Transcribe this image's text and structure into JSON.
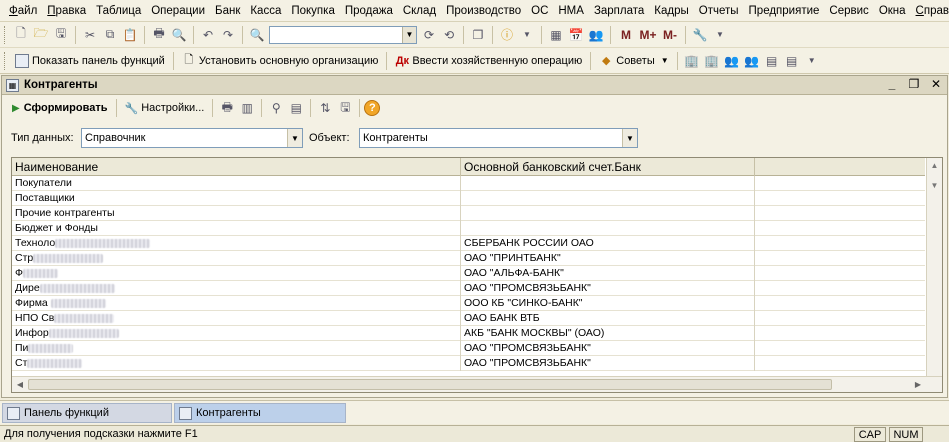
{
  "menu": [
    "Файл",
    "Правка",
    "Таблица",
    "Операции",
    "Банк",
    "Касса",
    "Покупка",
    "Продажа",
    "Склад",
    "Производство",
    "ОС",
    "НМА",
    "Зарплата",
    "Кадры",
    "Отчеты",
    "Предприятие",
    "Сервис",
    "Окна",
    "Справка"
  ],
  "menu_underline": [
    "Ф",
    "П",
    "",
    "",
    "",
    "",
    "",
    "",
    "",
    "",
    "",
    "",
    "",
    "",
    "",
    "",
    "",
    "",
    "С"
  ],
  "toolbar1": {
    "icons": [
      "new-doc-icon",
      "open-folder-icon",
      "save-icon",
      "cut-icon",
      "copy-icon",
      "paste-icon",
      "print-icon",
      "print-preview-icon",
      "undo-icon",
      "redo-icon",
      "search-icon"
    ],
    "search_value": "",
    "memory_buttons": [
      "M",
      "M+",
      "M-"
    ]
  },
  "toolbar2": {
    "show_panel": "Показать панель функций",
    "set_org": "Установить основную организацию",
    "enter_operation": "Ввести хозяйственную операцию",
    "tips": "Советы"
  },
  "window": {
    "title": "Контрагенты",
    "toolbar": {
      "generate": "Сформировать",
      "settings": "Настройки..."
    },
    "data_type_label": "Тип данных:",
    "data_type_value": "Справочник",
    "object_label": "Объект:",
    "object_value": "Контрагенты"
  },
  "table": {
    "columns": [
      "Наименование",
      "Основной банковский счет.Банк"
    ],
    "rows": [
      {
        "name": "Покупатели",
        "blur": 0,
        "bank": ""
      },
      {
        "name": "Поставщики",
        "blur": 0,
        "bank": ""
      },
      {
        "name": "Прочие контрагенты",
        "blur": 0,
        "bank": ""
      },
      {
        "name": "Бюджет и Фонды",
        "blur": 0,
        "bank": ""
      },
      {
        "name": "Техноло",
        "blur": 95,
        "bank": "СБЕРБАНК РОССИИ ОАО"
      },
      {
        "name": "Стр",
        "blur": 70,
        "bank": "ОАО \"ПРИНТБАНК\""
      },
      {
        "name": "Ф",
        "blur": 35,
        "bank": "ОАО \"АЛЬФА-БАНК\""
      },
      {
        "name": "Дире",
        "blur": 75,
        "bank": "ОАО \"ПРОМСВЯЗЬБАНК\""
      },
      {
        "name": "Фирма ",
        "blur": 55,
        "bank": "ООО КБ \"СИНКО-БАНК\""
      },
      {
        "name": "НПО Св",
        "blur": 60,
        "bank": "ОАО БАНК ВТБ"
      },
      {
        "name": "Инфор",
        "blur": 70,
        "bank": "АКБ \"БАНК МОСКВЫ\" (ОАО)"
      },
      {
        "name": "Пи",
        "blur": 45,
        "bank": "ОАО \"ПРОМСВЯЗЬБАНК\""
      },
      {
        "name": "Ст",
        "blur": 55,
        "bank": "ОАО \"ПРОМСВЯЗЬБАНК\""
      }
    ]
  },
  "taskbar": [
    "Панель функций",
    "Контрагенты"
  ],
  "status": {
    "hint": "Для получения подсказки нажмите F1",
    "cap": "CAP",
    "num": "NUM"
  }
}
